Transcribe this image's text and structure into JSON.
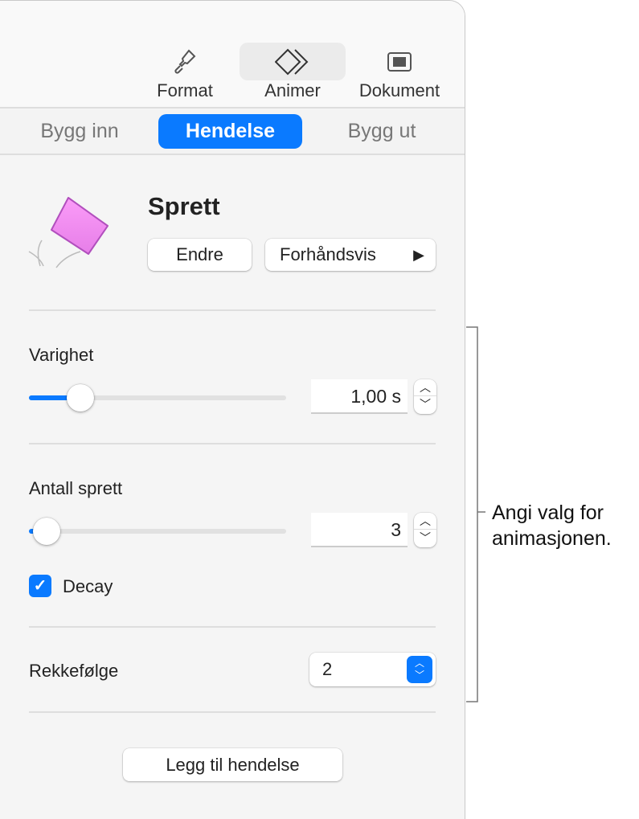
{
  "toolbar": {
    "items": [
      {
        "label": "Format",
        "icon": "paintbrush-icon"
      },
      {
        "label": "Animer",
        "icon": "animate-diamonds-icon",
        "selected": true
      },
      {
        "label": "Dokument",
        "icon": "document-icon"
      }
    ]
  },
  "tabs": [
    {
      "label": "Bygg inn"
    },
    {
      "label": "Hendelse",
      "selected": true
    },
    {
      "label": "Bygg ut"
    }
  ],
  "effect": {
    "name": "Sprett",
    "change_label": "Endre",
    "preview_label": "Forhåndsvis"
  },
  "duration": {
    "label": "Varighet",
    "value": "1,00 s",
    "slider_fraction": 0.2
  },
  "bounces": {
    "label": "Antall sprett",
    "value": "3",
    "slider_fraction": 0.07
  },
  "decay": {
    "label": "Decay",
    "checked": true
  },
  "order": {
    "label": "Rekkefølge",
    "value": "2"
  },
  "add_event_label": "Legg til hendelse",
  "callout": {
    "line1": "Angi valg for",
    "line2": "animasjonen."
  },
  "colors": {
    "accent": "#0a7aff",
    "effect_thumbnail": "#ee88f2"
  }
}
